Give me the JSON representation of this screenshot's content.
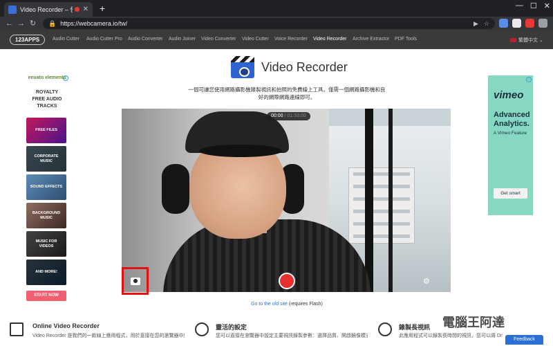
{
  "browser": {
    "tab_title": "Video Recorder – 使用網路",
    "tab_close": "✕",
    "new_tab": "+",
    "window_controls": [
      "—",
      "☐",
      "✕"
    ],
    "nav": {
      "back": "←",
      "forward": "→",
      "reload": "↻"
    },
    "lock": "🔒",
    "url": "https://webcamera.io/tw/",
    "omnibox_icons": [
      "▶",
      "☆"
    ],
    "extension_colors": [
      "#5b8ce6",
      "#e8eaed",
      "#e53935",
      "#9aa0a6"
    ]
  },
  "site_nav": {
    "logo": "123APPS",
    "links": [
      "Audio Cutter",
      "Audio Cutter Pro",
      "Audio Converter",
      "Audio Joiner",
      "Video Converter",
      "Video Cutter",
      "Voice Recorder",
      "Video Recorder",
      "Archive Extractor",
      "PDF Tools"
    ],
    "active": "Video Recorder",
    "language": "繁體中文 ⌄"
  },
  "left_ad": {
    "brand": "envato elements",
    "info": "i",
    "title_lines": [
      "ROYALTY",
      "FREE AUDIO",
      "TRACKS"
    ],
    "tiles": [
      "FREE FILES",
      "CORPORATE MUSIC",
      "SOUND EFFECTS",
      "BACKGROUND MUSIC",
      "MUSIC FOR VIDEOS",
      "AND MORE!"
    ],
    "cta": "START NOW"
  },
  "right_ad": {
    "info": "i",
    "brand": "vimeo",
    "headline": "Advanced Analytics.",
    "tagline": "A Vimeo Feature",
    "cta": "Get smart"
  },
  "main": {
    "title": "Video Recorder",
    "subtitle": "一個可讓您使用網路攝影機錄製視訊和拍照的免費線上工具。僅需一個網路攝影機和良好的網際網路連線即可。",
    "timer": {
      "current": "00:00",
      "separator": " / ",
      "max": "01:33:00"
    },
    "gear": "⚙",
    "old_site_link": "Go to the old site",
    "old_site_note": " (requires Flash)"
  },
  "features": [
    {
      "title": "Online Video Recorder",
      "text": "Video Recorder 是我們的一款線上應用程式，用於直接在您的瀏覽器中錄製網路攝影機"
    },
    {
      "title": "靈活的設定",
      "text": "您可以直接在瀏覽器中設定主要視訊錄製參數：選擇品質、開啟鏡像模式或擴大全螢幕顯示"
    },
    {
      "title": "錄製長視訊",
      "text": "此應用程式可以錄製長時間的視訊，您可以將 Drive 或 Dropbox 儲存"
    }
  ],
  "watermark": "電腦王阿達",
  "feedback": "Feedback"
}
